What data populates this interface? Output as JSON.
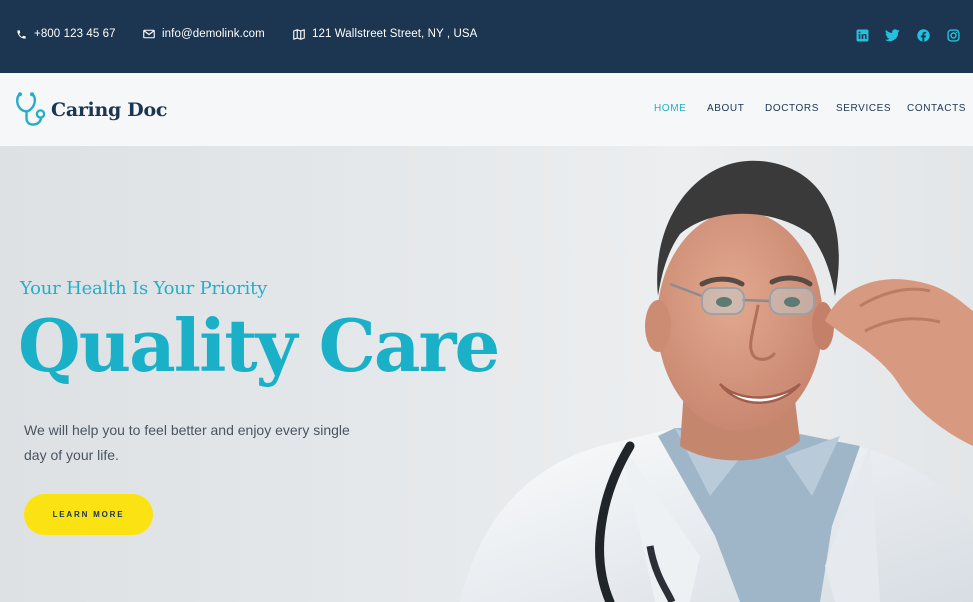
{
  "topbar": {
    "phone": "+800 123 45 67",
    "email": "info@demolink.com",
    "address": "121 Wallstreet Street, NY , USA",
    "social": [
      "linkedin-icon",
      "twitter-icon",
      "facebook-icon",
      "instagram-icon"
    ]
  },
  "header": {
    "logo_text": "Caring Doc",
    "nav": {
      "home": "HOME",
      "about": "ABOUT",
      "doctors": "DOCTORS",
      "services": "SERVICES",
      "contacts": "CONTACTS"
    }
  },
  "hero": {
    "tagline": "Your Health Is Your Priority",
    "headline": "Quality Care",
    "description": "We will help you to feel better and enjoy every single day of your life.",
    "button_label": "LEARN MORE"
  },
  "colors": {
    "topbar_bg": "#1c3550",
    "accent": "#25aec6",
    "button": "#fbe213"
  }
}
